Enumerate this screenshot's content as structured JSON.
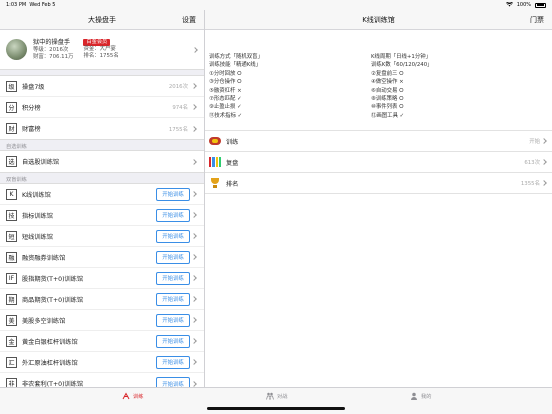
{
  "status": {
    "time": "1:03 PM",
    "date": "Wed Feb 5",
    "battery": "100%"
  },
  "left_nav": {
    "title": "大操盘手",
    "settings": "设置"
  },
  "profile": {
    "name": "狱中的操盘手",
    "vip": "白金会员",
    "level": "等级：2016次",
    "funds": "资金：大户宴",
    "assets": "财富：706.11万",
    "rank": "排名：1755名"
  },
  "stats": [
    {
      "box": "级",
      "label": "操盘7级",
      "value": "2016次"
    },
    {
      "box": "分",
      "label": "积分榜",
      "value": "974名"
    },
    {
      "box": "财",
      "label": "财富榜",
      "value": "1755名"
    }
  ],
  "custom_section": {
    "label": "自选训练"
  },
  "custom": [
    {
      "box": "选",
      "label": "自选股训练馆"
    }
  ],
  "double_section": {
    "label": "双盲训练"
  },
  "train_btn_label": "开始训练",
  "double": [
    {
      "box": "K",
      "label": "K线训练馆"
    },
    {
      "box": "技",
      "label": "指标训练馆"
    },
    {
      "box": "短",
      "label": "短线训练馆"
    },
    {
      "box": "融",
      "label": "融资融券训练馆"
    },
    {
      "box": "IF",
      "label": "股指期货(T+0)训练馆"
    },
    {
      "box": "期",
      "label": "商品期货(T+0)训练馆"
    },
    {
      "box": "美",
      "label": "美股多空训练馆"
    },
    {
      "box": "金",
      "label": "黄金白银杠杆训练馆"
    },
    {
      "box": "汇",
      "label": "外汇原油杠杆训练馆"
    },
    {
      "box": "非",
      "label": "非农套利(T+0)训练馆"
    }
  ],
  "right_nav": {
    "title": "K线训练馆",
    "ticket": "门票"
  },
  "info": {
    "col1": [
      "训练方式「随机双盲」",
      "训练技能「精通K线」",
      "①分时回放 ⭘",
      "③分仓操作 ⭘",
      "⑤融资杠杆 ×",
      "⑦形态匹配 ✓",
      "⑨止盈止损 ✓",
      "⑪技术指标 ✓"
    ],
    "col2": [
      "K线周期「日线+1分钟」",
      "训练K数「60/120/240」",
      "②复盘前三 ⭘",
      "④做空操作 ×",
      "⑥自动交易 ⭘",
      "⑧训练策略 ⭘",
      "⑩事件列表 ⭘",
      "⑫画图工具 ✓"
    ]
  },
  "actions": [
    {
      "icon": "train-icon",
      "label": "训练",
      "value": "开始"
    },
    {
      "icon": "review-icon",
      "label": "复盘",
      "value": "613次"
    },
    {
      "icon": "trophy-icon",
      "label": "排名",
      "value": "1355名"
    }
  ],
  "tabs": [
    {
      "label": "训练"
    },
    {
      "label": "对战"
    },
    {
      "label": "我的"
    }
  ],
  "colors": {
    "accent": "#d9252a",
    "button": "#3a8ee6"
  }
}
